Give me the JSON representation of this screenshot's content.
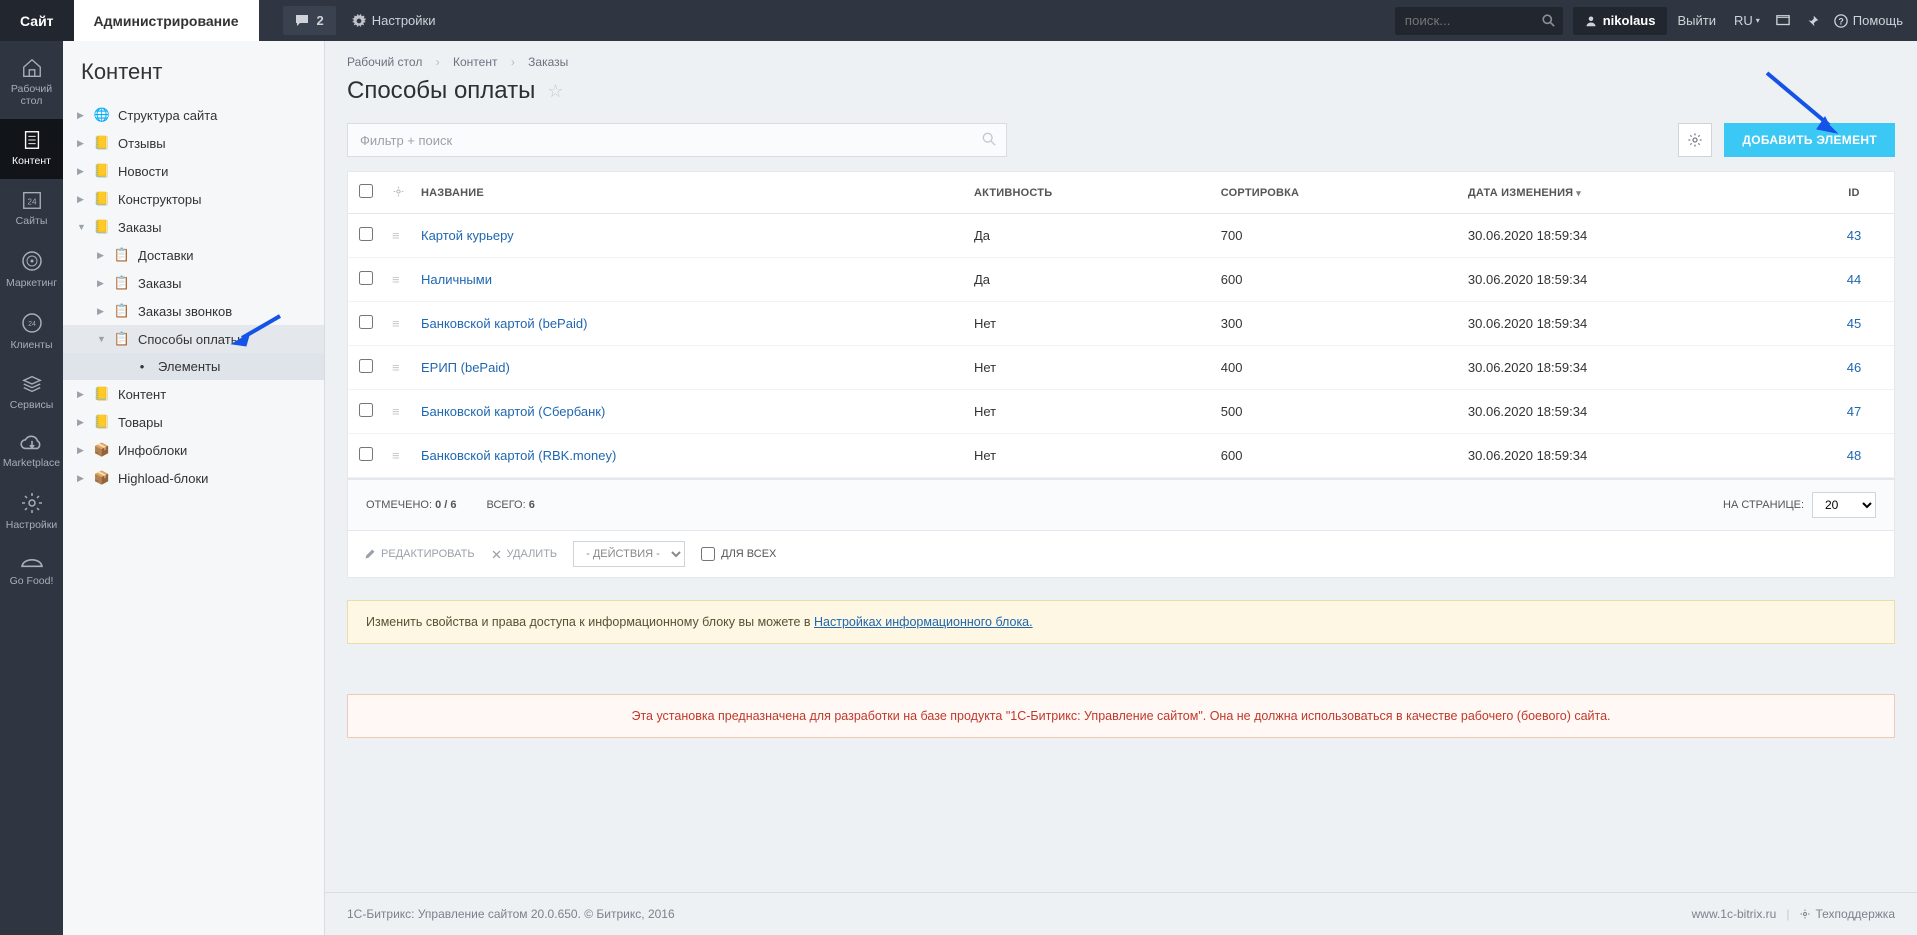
{
  "topbar": {
    "site_tab": "Сайт",
    "admin_tab": "Администрирование",
    "notif_count": "2",
    "settings": "Настройки",
    "search_placeholder": "поиск...",
    "username": "nikolaus",
    "logout": "Выйти",
    "lang": "RU",
    "help": "Помощь"
  },
  "rail": {
    "items": [
      {
        "label": "Рабочий стол"
      },
      {
        "label": "Контент"
      },
      {
        "label": "Сайты"
      },
      {
        "label": "Маркетинг"
      },
      {
        "label": "Клиенты"
      },
      {
        "label": "Сервисы"
      },
      {
        "label": "Marketplace"
      },
      {
        "label": "Настройки"
      },
      {
        "label": "Go Food!"
      }
    ]
  },
  "tree": {
    "title": "Контент",
    "items": [
      {
        "label": "Структура сайта"
      },
      {
        "label": "Отзывы"
      },
      {
        "label": "Новости"
      },
      {
        "label": "Конструкторы"
      },
      {
        "label": "Заказы"
      },
      {
        "label": "Контент"
      },
      {
        "label": "Товары"
      },
      {
        "label": "Инфоблоки"
      },
      {
        "label": "Highload-блоки"
      }
    ],
    "orders_sub": [
      {
        "label": "Доставки"
      },
      {
        "label": "Заказы"
      },
      {
        "label": "Заказы звонков"
      },
      {
        "label": "Способы оплаты"
      }
    ],
    "payment_sub": [
      {
        "label": "Элементы"
      }
    ]
  },
  "crumbs": {
    "desktop": "Рабочий стол",
    "content": "Контент",
    "orders": "Заказы"
  },
  "page": {
    "title": "Способы оплаты",
    "filter_placeholder": "Фильтр + поиск",
    "add_button": "ДОБАВИТЬ ЭЛЕМЕНТ"
  },
  "columns": {
    "name": "НАЗВАНИЕ",
    "active": "АКТИВНОСТЬ",
    "sort": "СОРТИРОВКА",
    "date": "ДАТА ИЗМЕНЕНИЯ",
    "id": "ID"
  },
  "rows": [
    {
      "name": "Картой курьеру",
      "active": "Да",
      "sort": "700",
      "date": "30.06.2020 18:59:34",
      "id": "43"
    },
    {
      "name": "Наличными",
      "active": "Да",
      "sort": "600",
      "date": "30.06.2020 18:59:34",
      "id": "44"
    },
    {
      "name": "Банковской картой (bePaid)",
      "active": "Нет",
      "sort": "300",
      "date": "30.06.2020 18:59:34",
      "id": "45"
    },
    {
      "name": "ЕРИП (bePaid)",
      "active": "Нет",
      "sort": "400",
      "date": "30.06.2020 18:59:34",
      "id": "46"
    },
    {
      "name": "Банковской картой (Сбербанк)",
      "active": "Нет",
      "sort": "500",
      "date": "30.06.2020 18:59:34",
      "id": "47"
    },
    {
      "name": "Банковской картой (RBK.money)",
      "active": "Нет",
      "sort": "600",
      "date": "30.06.2020 18:59:34",
      "id": "48"
    }
  ],
  "footer": {
    "selected_label": "ОТМЕЧЕНО:",
    "selected_value": "0 / 6",
    "total_label": "ВСЕГО:",
    "total_value": "6",
    "perpage_label": "НА СТРАНИЦЕ:",
    "perpage_value": "20"
  },
  "actions": {
    "edit": "РЕДАКТИРОВАТЬ",
    "delete": "УДАЛИТЬ",
    "actions_dd": "- ДЕЙСТВИЯ -",
    "for_all": "ДЛЯ ВСЕХ"
  },
  "info": {
    "text_prefix": "Изменить свойства и права доступа к информационному блоку вы можете в ",
    "link": "Настройках информационного блока."
  },
  "warn": {
    "text": "Эта установка предназначена для разработки на базе продукта \"1С-Битрикс: Управление сайтом\". Она не должна использоваться в качестве рабочего (боевого) сайта."
  },
  "pfoot": {
    "product": "1С-Битрикс: Управление сайтом 20.0.650. © Битрикс, 2016",
    "site": "www.1c-bitrix.ru",
    "support": "Техподдержка"
  }
}
